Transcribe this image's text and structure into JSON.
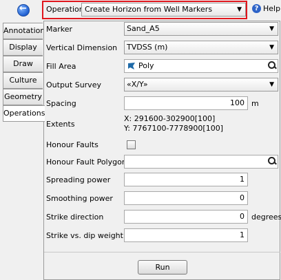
{
  "tabs": [
    "Annotation",
    "Display",
    "Draw",
    "Culture",
    "Geometry",
    "Operations"
  ],
  "active_tab": "Operations",
  "operation": {
    "label": "Operation",
    "value": "Create Horizon from Well Markers"
  },
  "help": {
    "label": "Help"
  },
  "form": {
    "marker": {
      "label": "Marker",
      "value": "Sand_A5"
    },
    "vertical_dimension": {
      "label": "Vertical Dimension",
      "value": "TVDSS (m)"
    },
    "fill_area": {
      "label": "Fill Area",
      "value": "Poly"
    },
    "output_survey": {
      "label": "Output Survey",
      "value": "«X/Y»"
    },
    "spacing": {
      "label": "Spacing",
      "value": "100",
      "unit": "m"
    },
    "extents": {
      "label": "Extents",
      "x": "X: 291600-302900[100]",
      "y": "Y: 7767100-7778900[100]"
    },
    "honour_faults": {
      "label": "Honour Faults",
      "checked": false
    },
    "honour_fault_polygons": {
      "label": "Honour Fault Polygons",
      "value": ""
    },
    "spreading_power": {
      "label": "Spreading power",
      "value": "1"
    },
    "smoothing_power": {
      "label": "Smoothing power",
      "value": "0"
    },
    "strike_direction": {
      "label": "Strike direction",
      "value": "0",
      "unit": "degrees"
    },
    "strike_vs_dip_weight": {
      "label": "Strike vs. dip weight",
      "value": "1"
    }
  },
  "run_button": {
    "label": "Run"
  },
  "colors": {
    "highlight": "#e0161d",
    "accent": "#2d63c8"
  }
}
